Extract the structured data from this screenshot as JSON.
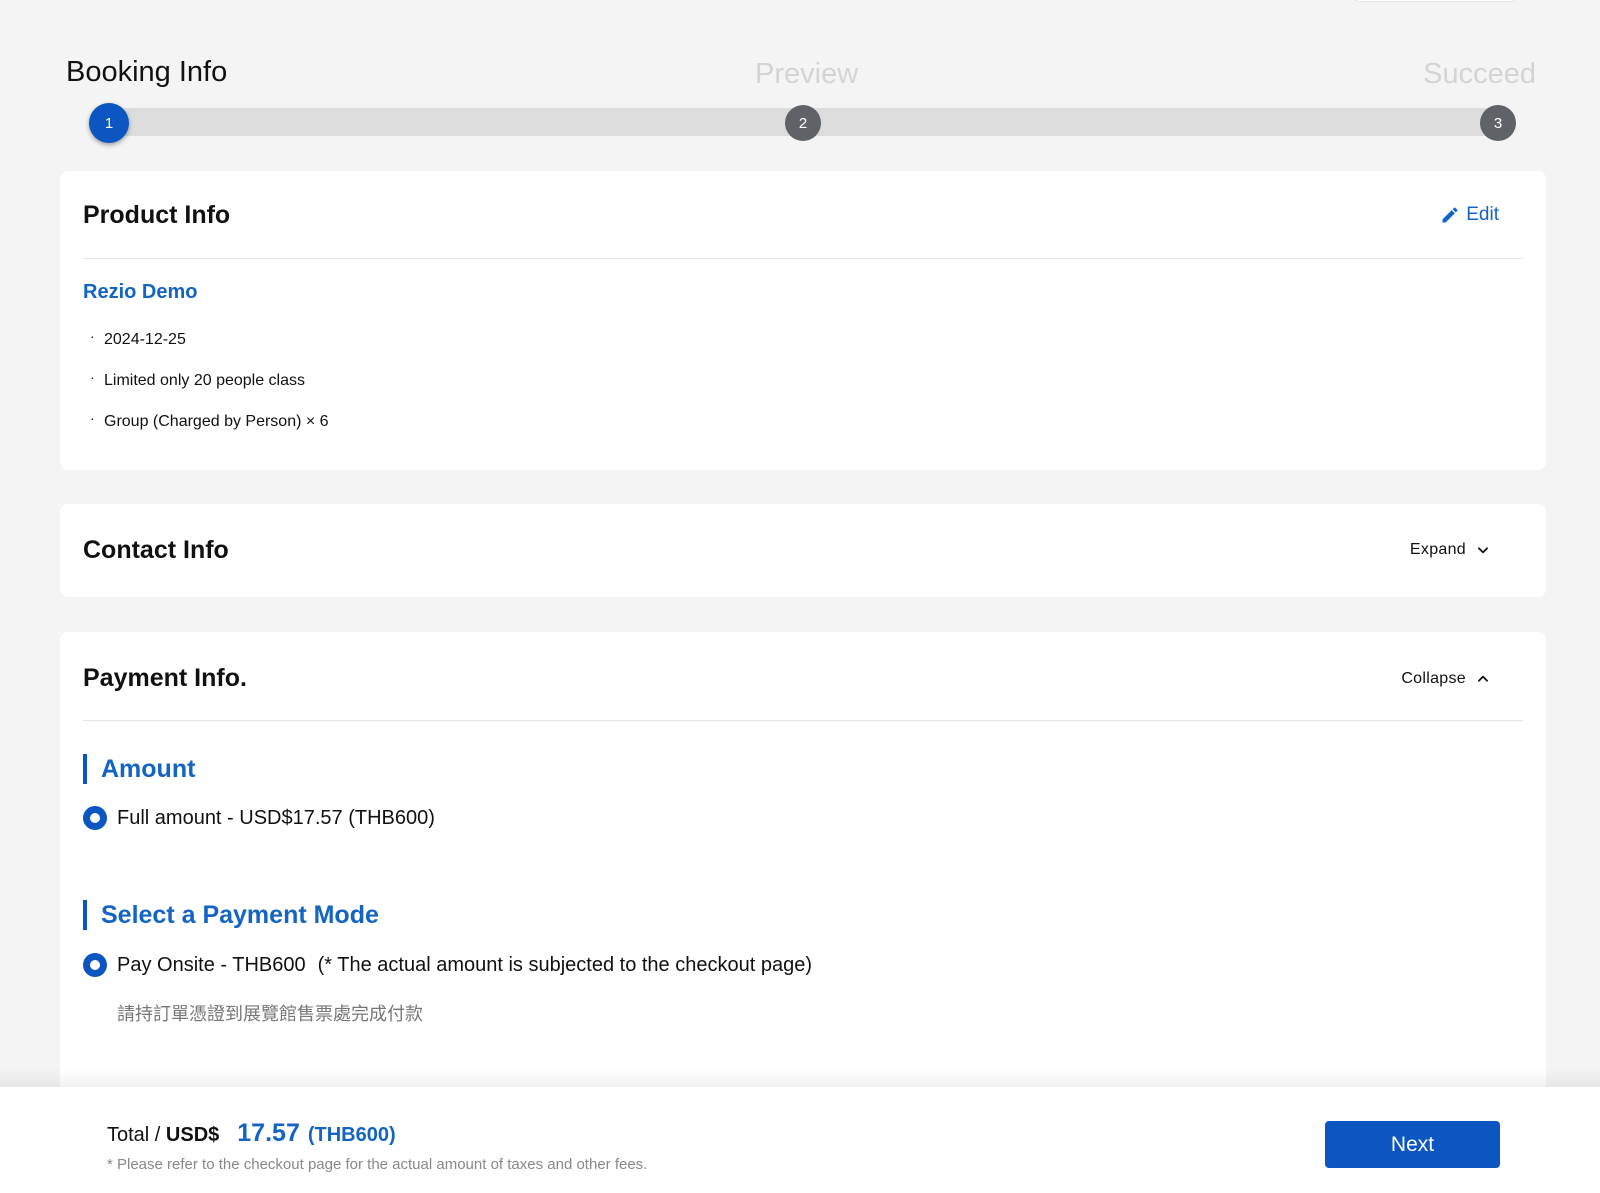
{
  "stepper": {
    "steps": [
      {
        "label": "Booking Info",
        "number": "1",
        "state": "active"
      },
      {
        "label": "Preview",
        "number": "2",
        "state": "inactive"
      },
      {
        "label": "Succeed",
        "number": "3",
        "state": "inactive"
      }
    ]
  },
  "product": {
    "title": "Product Info",
    "edit_label": "Edit",
    "name": "Rezio Demo",
    "details": [
      "2024-12-25",
      "Limited only 20 people class",
      "Group (Charged by Person) × 6"
    ]
  },
  "contact": {
    "title": "Contact Info",
    "toggle_label": "Expand"
  },
  "payment": {
    "title": "Payment Info.",
    "toggle_label": "Collapse",
    "amount_heading": "Amount",
    "amount_option": "Full amount - USD$17.57 (THB600)",
    "mode_heading": "Select a Payment Mode",
    "mode_option": "Pay Onsite - THB600",
    "mode_note": "(* The actual amount is subjected to the checkout page)",
    "mode_description": "請持訂單憑證到展覽館售票處完成付款"
  },
  "footer": {
    "total_prefix": "Total / ",
    "currency": "USD$",
    "amount": "17.57",
    "local_amount": "(THB600)",
    "note": "* Please refer to the checkout page for the actual amount of taxes and other fees.",
    "next_label": "Next"
  },
  "colors": {
    "primary": "#0b56c0",
    "link": "#1464c4",
    "step_inactive": "#5f6368",
    "background": "#f4f4f4"
  }
}
